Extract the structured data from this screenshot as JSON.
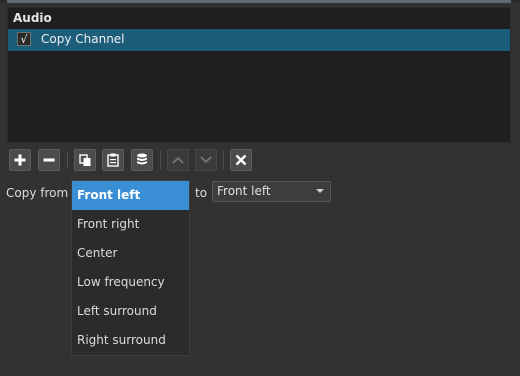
{
  "filters": {
    "group_header": "Audio",
    "items": [
      {
        "label": "Copy Channel",
        "checked": true,
        "check_glyph": "√"
      }
    ]
  },
  "toolbar": {
    "buttons": [
      {
        "name": "add-filter-button",
        "icon": "plus-icon"
      },
      {
        "name": "remove-filter-button",
        "icon": "minus-icon"
      },
      {
        "name": "copy-filter-button",
        "icon": "copy-icon"
      },
      {
        "name": "paste-filter-button",
        "icon": "paste-icon"
      },
      {
        "name": "filter-sets-button",
        "icon": "database-icon"
      },
      {
        "name": "move-up-button",
        "icon": "chevron-up-icon"
      },
      {
        "name": "move-down-button",
        "icon": "chevron-down-icon"
      },
      {
        "name": "close-filter-button",
        "icon": "close-icon"
      }
    ]
  },
  "copy_channel": {
    "from_label": "Copy from",
    "to_label": "to",
    "from_options": [
      "Front left",
      "Front right",
      "Center",
      "Low frequency",
      "Left surround",
      "Right surround"
    ],
    "from_selected": "Front left",
    "to_value": "Front left"
  },
  "colors": {
    "selection_row": "#1c5d79",
    "dropdown_highlight": "#3a8fd4",
    "background": "#323232"
  }
}
